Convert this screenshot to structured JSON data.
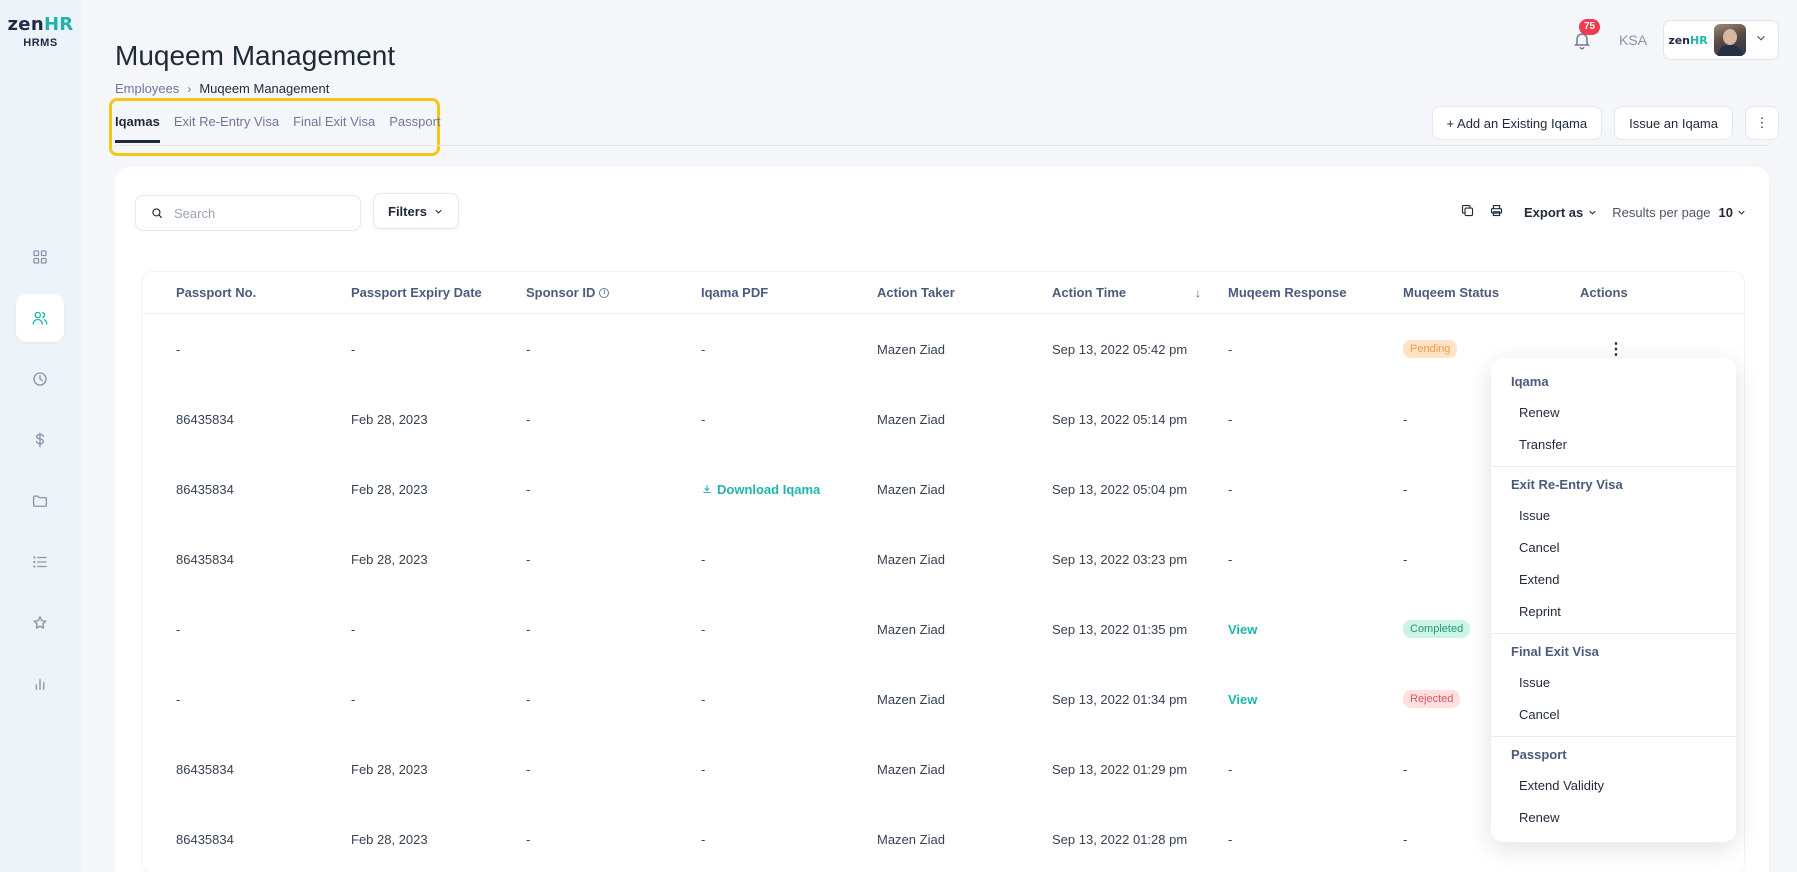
{
  "brand": {
    "logo_zen": "zen",
    "logo_hr": "HR",
    "logo_sub": "HRMS"
  },
  "sidebar": {
    "items": [
      {
        "icon": "dashboard-icon"
      },
      {
        "icon": "users-icon",
        "active": true
      },
      {
        "icon": "clock-icon"
      },
      {
        "icon": "dollar-icon"
      },
      {
        "icon": "folder-icon"
      },
      {
        "icon": "list-icon"
      },
      {
        "icon": "star-icon"
      },
      {
        "icon": "chart-icon"
      }
    ]
  },
  "header": {
    "title": "Muqeem Management",
    "breadcrumb": {
      "parent": "Employees",
      "separator": "›",
      "current": "Muqeem Management"
    },
    "notifications_count": "75",
    "region": "KSA"
  },
  "tabs": [
    {
      "label": "Iqamas",
      "active": true
    },
    {
      "label": "Exit Re-Entry Visa"
    },
    {
      "label": "Final Exit Visa"
    },
    {
      "label": "Passport"
    }
  ],
  "top_actions": {
    "add_existing": "+ Add an Existing Iqama",
    "issue": "Issue an Iqama",
    "more": "⋮"
  },
  "toolbar": {
    "search_placeholder": "Search",
    "filters_label": "Filters",
    "export_label": "Export as",
    "results_per_page_label": "Results per page",
    "results_per_page_value": "10"
  },
  "table": {
    "columns": [
      "Passport No.",
      "Passport Expiry Date",
      "Sponsor ID",
      "Iqama PDF",
      "Action Taker",
      "Action Time",
      "Muqeem Response",
      "Muqeem Status",
      "Actions"
    ],
    "rows": [
      {
        "passport": "-",
        "expiry": "-",
        "sponsor": "-",
        "pdf": "-",
        "taker": "Mazen Ziad",
        "time": "Sep 13, 2022 05:42 pm",
        "response": "-",
        "status": "Pending",
        "status_type": "pending"
      },
      {
        "passport": "86435834",
        "expiry": "Feb 28, 2023",
        "sponsor": "-",
        "pdf": "-",
        "taker": "Mazen Ziad",
        "time": "Sep 13, 2022 05:14 pm",
        "response": "-",
        "status": "-",
        "status_type": ""
      },
      {
        "passport": "86435834",
        "expiry": "Feb 28, 2023",
        "sponsor": "-",
        "pdf": "Download Iqama",
        "taker": "Mazen Ziad",
        "time": "Sep 13, 2022 05:04 pm",
        "response": "-",
        "status": "-",
        "status_type": ""
      },
      {
        "passport": "86435834",
        "expiry": "Feb 28, 2023",
        "sponsor": "-",
        "pdf": "-",
        "taker": "Mazen Ziad",
        "time": "Sep 13, 2022 03:23 pm",
        "response": "-",
        "status": "-",
        "status_type": ""
      },
      {
        "passport": "-",
        "expiry": "-",
        "sponsor": "-",
        "pdf": "-",
        "taker": "Mazen Ziad",
        "time": "Sep 13, 2022 01:35 pm",
        "response": "View",
        "status": "Completed",
        "status_type": "completed"
      },
      {
        "passport": "-",
        "expiry": "-",
        "sponsor": "-",
        "pdf": "-",
        "taker": "Mazen Ziad",
        "time": "Sep 13, 2022 01:34 pm",
        "response": "View",
        "status": "Rejected",
        "status_type": "rejected"
      },
      {
        "passport": "86435834",
        "expiry": "Feb 28, 2023",
        "sponsor": "-",
        "pdf": "-",
        "taker": "Mazen Ziad",
        "time": "Sep 13, 2022 01:29 pm",
        "response": "-",
        "status": "-",
        "status_type": ""
      },
      {
        "passport": "86435834",
        "expiry": "Feb 28, 2023",
        "sponsor": "-",
        "pdf": "-",
        "taker": "Mazen Ziad",
        "time": "Sep 13, 2022 01:28 pm",
        "response": "-",
        "status": "-",
        "status_type": ""
      }
    ]
  },
  "actions_menu": {
    "groups": [
      {
        "heading": "Iqama",
        "items": [
          "Renew",
          "Transfer"
        ]
      },
      {
        "heading": "Exit Re-Entry Visa",
        "items": [
          "Issue",
          "Cancel",
          "Extend",
          "Reprint"
        ]
      },
      {
        "heading": "Final Exit Visa",
        "items": [
          "Issue",
          "Cancel"
        ]
      },
      {
        "heading": "Passport",
        "items": [
          "Extend Validity",
          "Renew"
        ]
      }
    ]
  },
  "colors": {
    "accent": "#1fb5ad",
    "highlight": "#f5c518",
    "pending": "#f29b48",
    "completed": "#1c9c72",
    "rejected": "#e0565a"
  }
}
